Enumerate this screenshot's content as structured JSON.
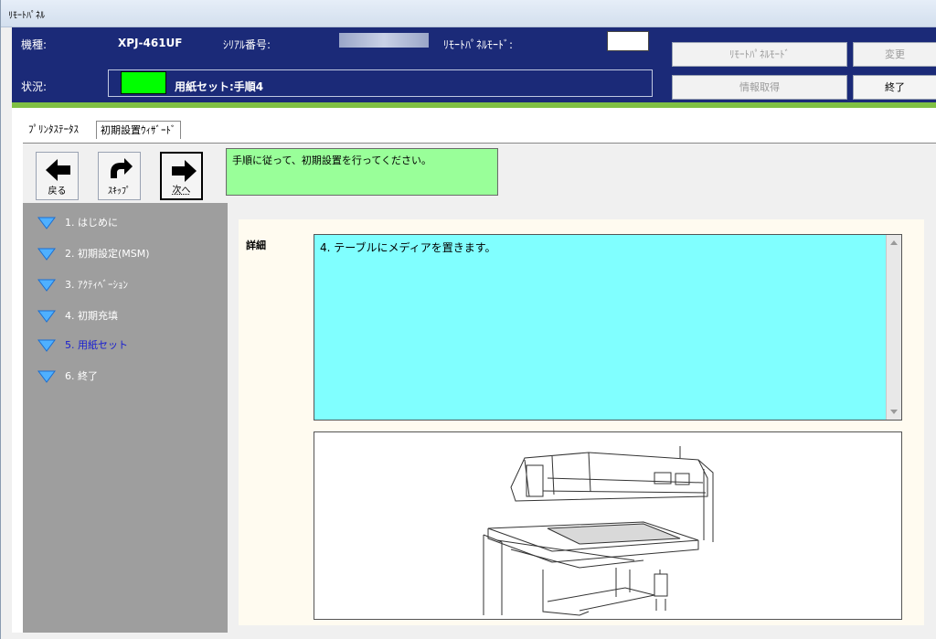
{
  "window": {
    "title": "ﾘﾓｰﾄﾊﾟﾈﾙ"
  },
  "header": {
    "model_label": "機種:",
    "model_value": "XPJ-461UF",
    "serial_label": "ｼﾘｱﾙ番号:",
    "panel_mode_label": "ﾘﾓｰﾄﾊﾟﾈﾙﾓｰﾄﾞ:",
    "status_label": "状況:",
    "status_value": "用紙セット:手順4",
    "status_color": "#00ff00",
    "buttons": {
      "remote_panel_mode": "ﾘﾓｰﾄﾊﾟﾈﾙﾓｰﾄﾞ",
      "change": "変更",
      "get_info": "情報取得",
      "exit": "終了"
    }
  },
  "tabs": [
    {
      "label": "ﾌﾟﾘﾝﾀｽﾃｰﾀｽ",
      "selected": false
    },
    {
      "label": "初期設置ｳｨｻﾞｰﾄﾞ",
      "selected": true
    }
  ],
  "toolbar": {
    "back_label": "戻る",
    "skip_label": "ｽｷｯﾌﾟ",
    "next_label": "次へ",
    "message": "手順に従って、初期設置を行ってください。"
  },
  "steps": [
    {
      "label": "1. はじめに",
      "current": false
    },
    {
      "label": "2. 初期設定(MSM)",
      "current": false
    },
    {
      "label": "3. ｱｸﾃｨﾍﾞｰｼｮﾝ",
      "current": false
    },
    {
      "label": "4. 初期充填",
      "current": false
    },
    {
      "label": "5. 用紙セット",
      "current": true
    },
    {
      "label": "6. 終了",
      "current": false
    }
  ],
  "detail": {
    "label": "詳細",
    "text": "4. テーブルにメディアを置きます。"
  },
  "colors": {
    "header_bg": "#1b2a78",
    "message_bg": "#99ff99",
    "detail_bg": "#80ffff",
    "step_current": "#1a20d0"
  }
}
